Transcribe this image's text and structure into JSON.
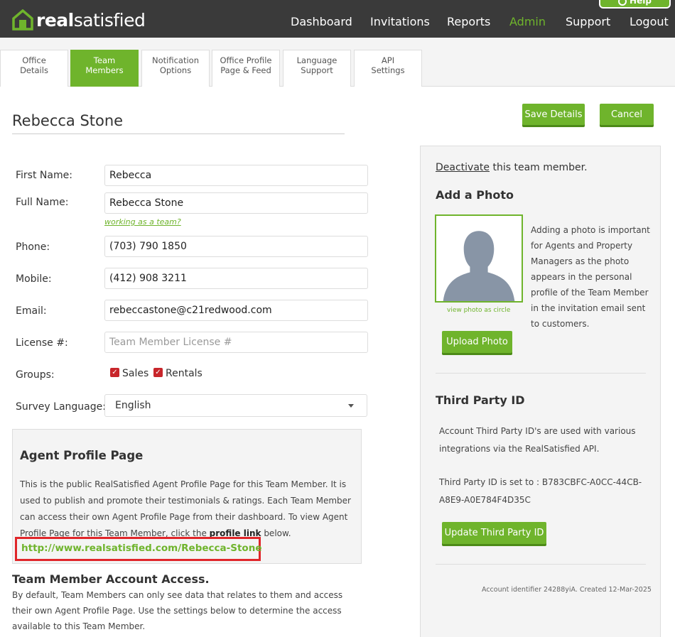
{
  "header": {
    "logo_bold": "real",
    "logo_light": "satisfied",
    "help_label": "Help",
    "nav": [
      {
        "label": "Dashboard",
        "active": false
      },
      {
        "label": "Invitations",
        "active": false
      },
      {
        "label": "Reports",
        "active": false
      },
      {
        "label": "Admin",
        "active": true
      },
      {
        "label": "Support",
        "active": false
      },
      {
        "label": "Logout",
        "active": false
      }
    ]
  },
  "tabs": [
    {
      "line1": "Office",
      "line2": "Details",
      "active": false
    },
    {
      "line1": "Team",
      "line2": "Members",
      "active": true
    },
    {
      "line1": "Notification",
      "line2": "Options",
      "active": false
    },
    {
      "line1": "Office Profile",
      "line2": "Page & Feed",
      "active": false
    },
    {
      "line1": "Language",
      "line2": "Support",
      "active": false
    },
    {
      "line1": "API",
      "line2": "Settings",
      "active": false
    }
  ],
  "page": {
    "member_name": "Rebecca Stone",
    "save_label": "Save Details",
    "cancel_label": "Cancel"
  },
  "form": {
    "first_name_label": "First Name:",
    "first_name_value": "Rebecca",
    "full_name_label": "Full Name:",
    "full_name_value": "Rebecca Stone",
    "team_link": "working as a team?",
    "phone_label": "Phone:",
    "phone_value": "(703) 790 1850",
    "mobile_label": "Mobile:",
    "mobile_value": "(412) 908 3211",
    "email_label": "Email:",
    "email_value": "rebeccastone@c21redwood.com",
    "license_label": "License #:",
    "license_placeholder": "Team Member License #",
    "groups_label": "Groups:",
    "group_sales": "Sales",
    "group_rentals": "Rentals",
    "language_label": "Survey Language:",
    "language_value": "English"
  },
  "profile": {
    "title": "Agent Profile Page",
    "text_before": "This is the public RealSatisfied Agent Profile Page for this Team Member. It is used to publish and promote their testimonials & ratings. Each Team Member can access their own Agent Profile Page from their dashboard. To view Agent Profile Page for this Team Member, click the ",
    "text_bold": "profile link",
    "text_after": " below.",
    "link": "http://www.realsatisfied.com/Rebecca-Stone"
  },
  "access": {
    "title": "Team Member Account Access.",
    "text": "By default, Team Members can only see data that relates to them and access their own Agent Profile Page. Use the settings below to determine the access available to this Team Member."
  },
  "right": {
    "deactivate_link": "Deactivate",
    "deactivate_rest": " this team member.",
    "photo_title": "Add a Photo",
    "view_circle": "view photo as circle",
    "photo_text": "Adding a photo is important for Agents and Property Managers as the photo appears in the personal profile of the Team Member in the invitation email sent to customers.",
    "upload_label": "Upload Photo",
    "third_title": "Third Party ID",
    "third_text": "Account Third Party ID's are used with various integrations via the RealSatisfied API.",
    "third_id_text": "Third Party ID is set to : B783CBFC-A0CC-44CB-A8E9-A0E784F4D35C",
    "update_label": "Update Third Party ID",
    "account_identifier": "Account identifier 24288yiA. Created 12-Mar-2025"
  },
  "colors": {
    "brand_green": "#6fb42c",
    "topbar": "#3a3a3a",
    "highlight_red": "#e0262a",
    "checkbox_red": "#c8262b"
  }
}
